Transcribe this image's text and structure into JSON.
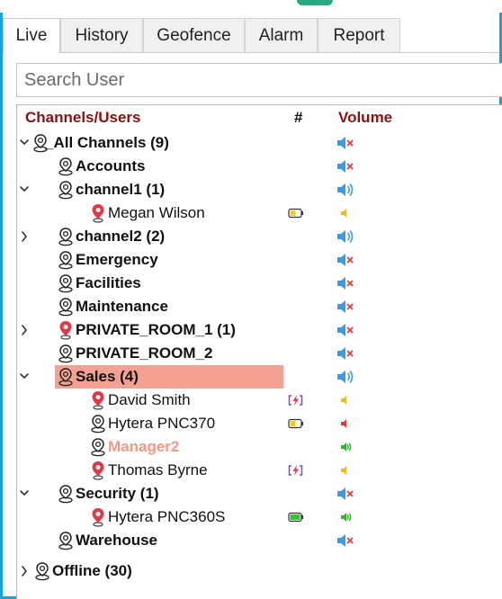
{
  "tabs": [
    {
      "label": "Live",
      "active": true
    },
    {
      "label": "History",
      "active": false
    },
    {
      "label": "Geofence",
      "active": false
    },
    {
      "label": "Alarm",
      "active": false
    },
    {
      "label": "Report",
      "active": false
    }
  ],
  "search": {
    "placeholder": "Search User"
  },
  "columns": {
    "name": "Channels/Users",
    "number": "#",
    "volume": "Volume"
  },
  "rows": [
    {
      "label": "_All Channels (9)",
      "type": "channel",
      "expander": "expanded",
      "bold": true,
      "volume": "muted"
    },
    {
      "label": "Accounts",
      "type": "channel",
      "expander": "none",
      "bold": true,
      "volume": "muted"
    },
    {
      "label": "channel1 (1)",
      "type": "channel",
      "expander": "expanded",
      "bold": true,
      "volume": "on"
    },
    {
      "label": "Megan Wilson",
      "type": "user",
      "icon": "red-pin",
      "battery": "yellow",
      "volume": "low-orange"
    },
    {
      "label": "channel2 (2)",
      "type": "channel",
      "expander": "collapsed",
      "bold": true,
      "volume": "on"
    },
    {
      "label": "Emergency",
      "type": "channel",
      "expander": "none",
      "bold": true,
      "volume": "muted"
    },
    {
      "label": "Facilities",
      "type": "channel",
      "expander": "none",
      "bold": true,
      "volume": "muted"
    },
    {
      "label": "Maintenance",
      "type": "channel",
      "expander": "none",
      "bold": true,
      "volume": "muted"
    },
    {
      "label": "PRIVATE_ROOM_1 (1)",
      "type": "channel",
      "expander": "collapsed",
      "bold": true,
      "icon": "red-pin",
      "volume": "muted"
    },
    {
      "label": "PRIVATE_ROOM_2",
      "type": "channel",
      "expander": "none",
      "bold": true,
      "volume": "muted"
    },
    {
      "label": "Sales (4)",
      "type": "channel",
      "expander": "expanded",
      "bold": true,
      "selected": true,
      "volume": "on"
    },
    {
      "label": "David Smith",
      "type": "user",
      "icon": "red-pin",
      "battery": "charging",
      "volume": "low-orange"
    },
    {
      "label": "Hytera PNC370",
      "type": "user",
      "icon": "outline",
      "battery": "yellow",
      "volume": "red"
    },
    {
      "label": "Manager2",
      "type": "user",
      "icon": "outline",
      "orange": true,
      "volume": "green"
    },
    {
      "label": "Thomas Byrne",
      "type": "user",
      "icon": "red-pin",
      "battery": "charging",
      "volume": "low-orange"
    },
    {
      "label": "Security (1)",
      "type": "channel",
      "expander": "expanded",
      "bold": true,
      "volume": "muted"
    },
    {
      "label": "Hytera PNC360S",
      "type": "user",
      "icon": "red-pin",
      "battery": "green",
      "volume": "green"
    },
    {
      "label": "Warehouse",
      "type": "channel",
      "expander": "none",
      "bold": true,
      "volume": "muted"
    },
    {
      "label": "Offline (30)",
      "type": "channel",
      "expander": "collapsed",
      "bold": true,
      "volume": "none"
    }
  ],
  "colors": {
    "accent": "#1aa3d9",
    "header_text": "#8b1010",
    "selection": "#f4a092",
    "volume_blue": "#3a9be0",
    "mute_red": "#e23c3c",
    "pin_red": "#e03a4a",
    "orange_name": "#f09a86"
  }
}
